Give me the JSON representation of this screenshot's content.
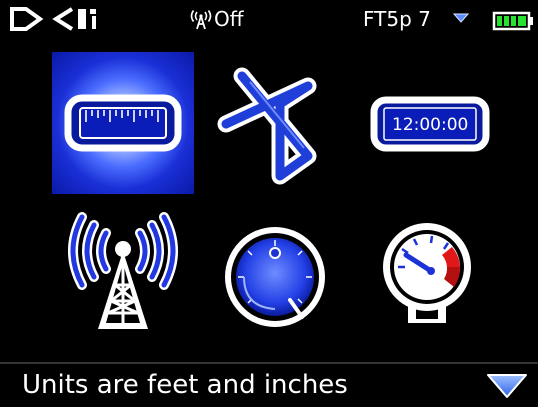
{
  "status_bar": {
    "logo_text": "DCI",
    "radio_icon": "antenna-signal-icon",
    "radio_status": "Off",
    "channel": "FT5p 7",
    "channel_menu_icon": "chevron-down-icon",
    "battery_icon": "battery-full-icon"
  },
  "menu": {
    "items": [
      {
        "name": "units",
        "icon": "ruler-icon",
        "selected": true
      },
      {
        "name": "bluetooth",
        "icon": "bluetooth-icon",
        "selected": false
      },
      {
        "name": "time",
        "icon": "clock-icon",
        "clock_text": "12:00:00",
        "selected": false
      },
      {
        "name": "telemetry",
        "icon": "radio-tower-icon",
        "selected": false
      },
      {
        "name": "pitch",
        "icon": "pitch-dial-icon",
        "selected": false
      },
      {
        "name": "pressure",
        "icon": "pressure-gauge-icon",
        "selected": false
      }
    ]
  },
  "bottom_bar": {
    "status_message": "Units are feet and inches",
    "next_icon": "triangle-down-icon"
  },
  "colors": {
    "background": "#000000",
    "accent_blue": "#2d4cff",
    "selected_glow": "#1a2fd6",
    "battery_green": "#22d22a",
    "gauge_red": "#e01818"
  }
}
